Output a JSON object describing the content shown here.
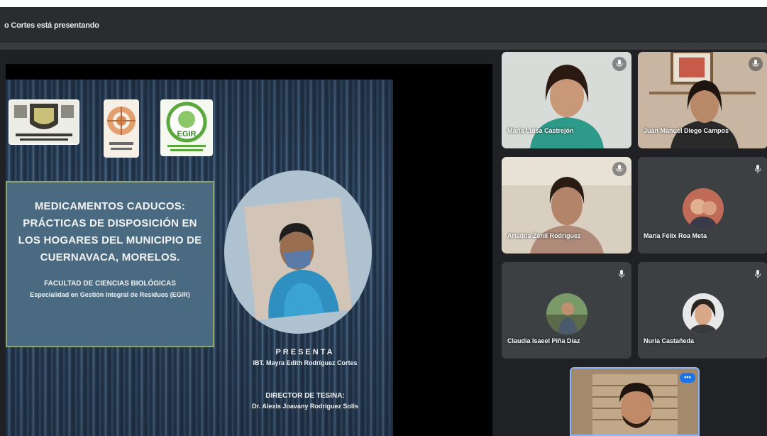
{
  "topbar": {
    "presenting_text": "o Cortes está presentando"
  },
  "slide": {
    "title": "MEDICAMENTOS CADUCOS: PRÁCTICAS DE DISPOSICIÓN EN LOS HOGARES DEL MUNICIPIO DE CUERNAVACA, MORELOS.",
    "faculty": "FACULTAD DE CIENCIAS BIOLÓGICAS",
    "specialty": "Especialidad en Gestión Integral de Residuos (EGIR)",
    "presents_label": "PRESENTA",
    "presenter": "IBT. Mayra Edith Rodríguez Cortes",
    "director_label": "DIRECTOR DE TESINA:",
    "director": "Dr. Alexis Joavany Rodríguez Solís",
    "logos": {
      "uaem": "uaem-logo",
      "fcb": "fcb-logo",
      "egir": "egir-logo"
    }
  },
  "participants": [
    {
      "name": "María Luisa Castrejón",
      "mic": "mic-icon"
    },
    {
      "name": "Juan Manuel Diego Campos",
      "mic": "mic-icon"
    },
    {
      "name": "Ariadna Zenil Rodríguez",
      "mic": "mic-icon"
    },
    {
      "name": "María Félix Roa Meta",
      "mic": "mic-off-icon"
    },
    {
      "name": "Claudia Isaeel Piña Díaz",
      "mic": "mic-off-icon"
    },
    {
      "name": "Nuria Castañeda",
      "mic": "mic-off-icon"
    }
  ],
  "self_view": {
    "more_label": "•••"
  },
  "colors": {
    "background": "#202124",
    "tile": "#3c4043",
    "accent": "#1a73e8"
  }
}
